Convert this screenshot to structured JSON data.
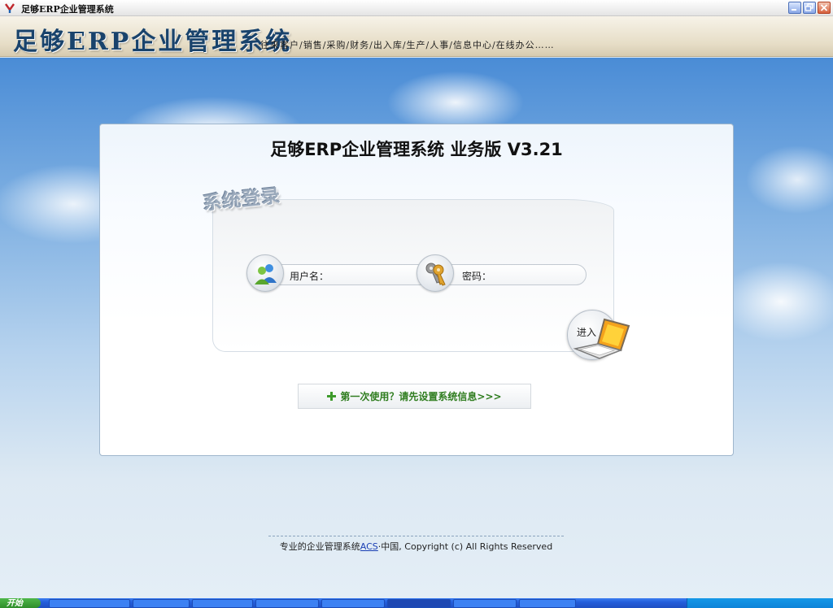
{
  "window": {
    "title": "足够ERP企业管理系统"
  },
  "banner": {
    "title": "足够ERP企业管理系统",
    "tagline": "往来客户/销售/采购/财务/出入库/生产/人事/信息中心/在线办公……"
  },
  "login": {
    "panel_title": "足够ERP企业管理系统 业务版 V3.21",
    "heading": "系统登录",
    "username_label": "用户名：",
    "username_value": "",
    "password_label": "密码：",
    "password_value": "",
    "enter_label": "进入",
    "setup_link": "第一次使用？请先设置系统信息>>>"
  },
  "footer": {
    "prefix": "专业的企业管理系统",
    "link": "ACS",
    "suffix": "·中国, Copyright (c) All Rights Reserved"
  },
  "taskbar": {
    "start_label": "开始",
    "items": [
      "",
      "",
      "",
      "",
      "",
      "",
      "",
      ""
    ]
  },
  "colors": {
    "banner_title": "#19436c",
    "setup_link": "#2f7d1f",
    "panel_border": "#9fb6cc"
  }
}
